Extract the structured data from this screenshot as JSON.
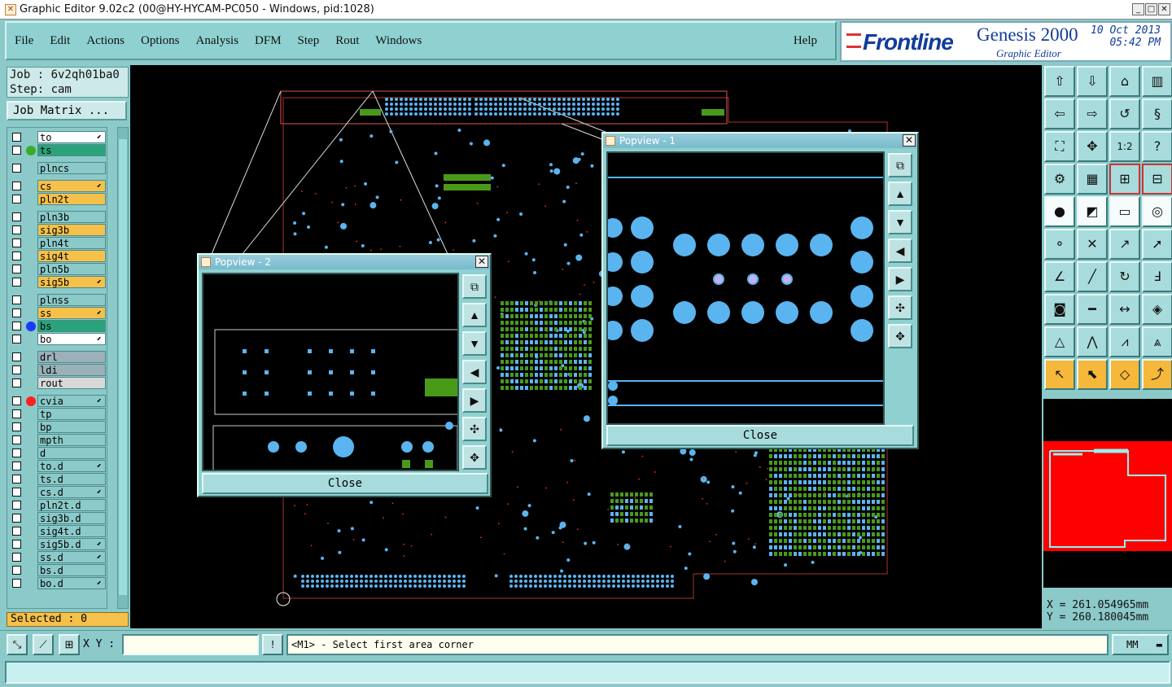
{
  "window": {
    "title": "Graphic Editor 9.02c2 (00@HY-HYCAM-PC050 - Windows, pid:1028)"
  },
  "menus": [
    "File",
    "Edit",
    "Actions",
    "Options",
    "Analysis",
    "DFM",
    "Step",
    "Rout",
    "Windows"
  ],
  "help_label": "Help",
  "brand": {
    "logo": "Frontline",
    "product": "Genesis 2000",
    "subtitle": "Graphic Editor",
    "date": "10 Oct 2013",
    "time": "05:42 PM"
  },
  "job": {
    "job_line": "Job : 6v2qh01ba0",
    "step_line": "Step: cam",
    "matrix_button": "Job Matrix ..."
  },
  "layers": [
    {
      "name": "to",
      "color": "#ffffff",
      "dot": "",
      "mark": true
    },
    {
      "name": "ts",
      "color": "#2aa37a",
      "dot": "#3aaa2a",
      "mark": false
    },
    {
      "name": "plncs",
      "color": "#8cc9c9",
      "dot": "",
      "mark": false
    },
    {
      "name": "cs",
      "color": "#f5c14a",
      "dot": "",
      "mark": true
    },
    {
      "name": "pln2t",
      "color": "#f5c14a",
      "dot": "",
      "mark": false
    },
    {
      "name": "pln3b",
      "color": "#8cc9c9",
      "dot": "",
      "mark": false
    },
    {
      "name": "sig3b",
      "color": "#f5c14a",
      "dot": "",
      "mark": false
    },
    {
      "name": "pln4t",
      "color": "#8cc9c9",
      "dot": "",
      "mark": false
    },
    {
      "name": "sig4t",
      "color": "#f5c14a",
      "dot": "",
      "mark": false
    },
    {
      "name": "pln5b",
      "color": "#8cc9c9",
      "dot": "",
      "mark": false
    },
    {
      "name": "sig5b",
      "color": "#f5c14a",
      "dot": "",
      "mark": true
    },
    {
      "name": "plnss",
      "color": "#8cc9c9",
      "dot": "",
      "mark": false
    },
    {
      "name": "ss",
      "color": "#f5c14a",
      "dot": "",
      "mark": true
    },
    {
      "name": "bs",
      "color": "#2aa37a",
      "dot": "#1a3aff",
      "mark": false
    },
    {
      "name": "bo",
      "color": "#ffffff",
      "dot": "",
      "mark": true
    },
    {
      "name": "drl",
      "color": "#9bb0b8",
      "dot": "",
      "mark": false
    },
    {
      "name": "ldi",
      "color": "#9bb0b8",
      "dot": "",
      "mark": false
    },
    {
      "name": "rout",
      "color": "#d8d8d8",
      "dot": "",
      "mark": false
    },
    {
      "name": "cvia",
      "color": "#8cc9c9",
      "dot": "#ff2020",
      "mark": true
    },
    {
      "name": "tp",
      "color": "#8cc9c9",
      "dot": "",
      "mark": false
    },
    {
      "name": "bp",
      "color": "#8cc9c9",
      "dot": "",
      "mark": false
    },
    {
      "name": "mpth",
      "color": "#8cc9c9",
      "dot": "",
      "mark": false
    },
    {
      "name": "d",
      "color": "#8cc9c9",
      "dot": "",
      "mark": false
    },
    {
      "name": "to.d",
      "color": "#8cc9c9",
      "dot": "",
      "mark": true
    },
    {
      "name": "ts.d",
      "color": "#8cc9c9",
      "dot": "",
      "mark": false
    },
    {
      "name": "cs.d",
      "color": "#8cc9c9",
      "dot": "",
      "mark": true
    },
    {
      "name": "pln2t.d",
      "color": "#8cc9c9",
      "dot": "",
      "mark": false
    },
    {
      "name": "sig3b.d",
      "color": "#8cc9c9",
      "dot": "",
      "mark": false
    },
    {
      "name": "sig4t.d",
      "color": "#8cc9c9",
      "dot": "",
      "mark": false
    },
    {
      "name": "sig5b.d",
      "color": "#8cc9c9",
      "dot": "",
      "mark": true
    },
    {
      "name": "ss.d",
      "color": "#8cc9c9",
      "dot": "",
      "mark": true
    },
    {
      "name": "bs.d",
      "color": "#8cc9c9",
      "dot": "",
      "mark": false
    },
    {
      "name": "bo.d",
      "color": "#8cc9c9",
      "dot": "",
      "mark": true
    }
  ],
  "selected": "Selected : 0",
  "popview1": {
    "title": "Popview - 1",
    "close_label": "Close"
  },
  "popview2": {
    "title": "Popview - 2",
    "close_label": "Close"
  },
  "coords": {
    "x": "X = 261.054965mm",
    "y": "Y = 260.180045mm"
  },
  "bottom": {
    "xy_label": "X Y :",
    "xy_value": "",
    "excl": "!",
    "prompt": "<M1> - Select first area corner",
    "units": "MM"
  },
  "colors": {
    "pad": "#5ab4f0",
    "copper": "#4a9a1a",
    "via": "#ff3030",
    "panel": "#8cc9c9"
  }
}
